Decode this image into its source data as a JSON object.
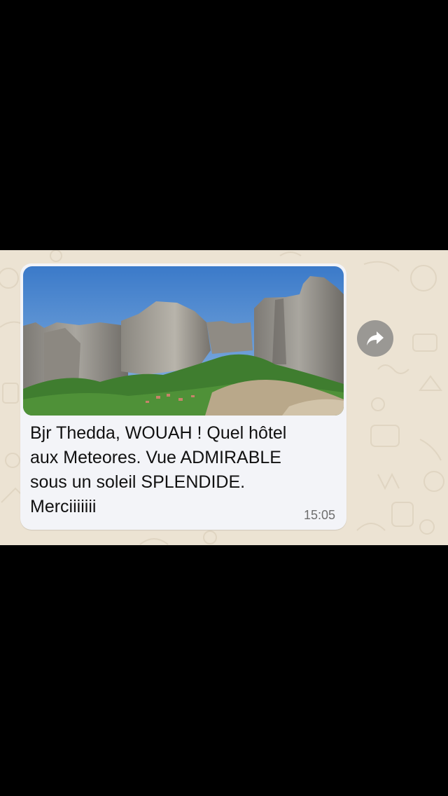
{
  "message": {
    "text": "Bjr Thedda, WOUAH ! Quel hôtel\naux Meteores. Vue ADMIRABLE\nsous un soleil SPLENDIDE.\nMerciiiiiii",
    "time": "15:05",
    "photo_alt": "photo",
    "bubble_color": "#f3f4f8"
  },
  "forward": {
    "icon": "forward-arrow-icon",
    "color": "#9a9894"
  },
  "chat": {
    "wallpaper_color": "#ece3d3"
  }
}
